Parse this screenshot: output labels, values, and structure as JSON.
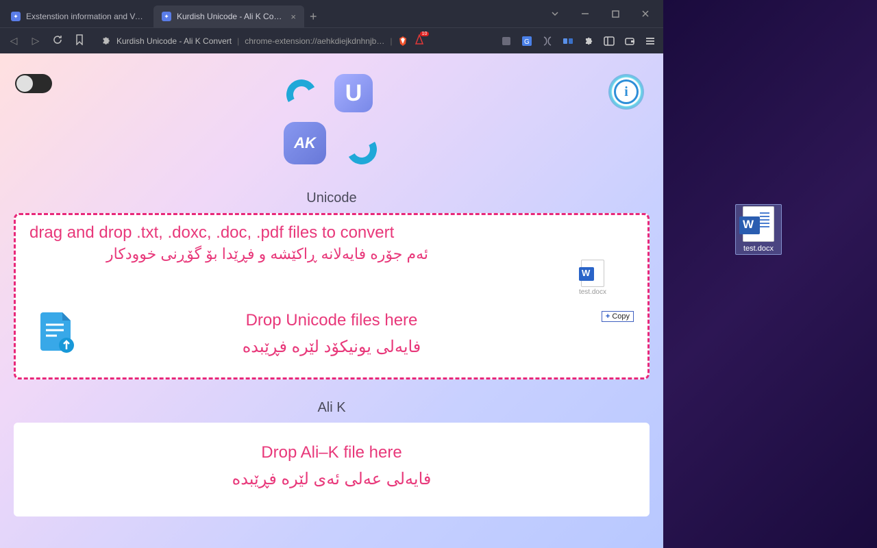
{
  "browser": {
    "tabs": [
      {
        "title": "Exstenstion information and Version",
        "active": false
      },
      {
        "title": "Kurdish Unicode - Ali K Converter",
        "active": true
      }
    ],
    "address": {
      "title": "Kurdish Unicode - Ali K Convert",
      "url": "chrome-extension://aehkdiejkdnhnjb…"
    },
    "shield_badge": "10"
  },
  "page": {
    "logo": {
      "u": "U",
      "ak": "AK"
    },
    "info_label": "i",
    "unicode": {
      "label": "Unicode",
      "hint_en": "drag and drop .txt, .doxc, .doc, .pdf files to convert",
      "hint_ku": "ئەم جۆرە فایەلانە ڕاکێشە و فڕێدا بۆ گۆڕنی خوودکار",
      "drop_en": "Drop Unicode files here",
      "drop_ku": "فایەلی یونیکۆد لێرە فڕێبدە"
    },
    "alik": {
      "label": "Ali K",
      "drop_en": "Drop Ali–K file here",
      "drop_ku": "فایەلی عەلی ئەی لێرە فڕێبدە"
    },
    "drag": {
      "file_name": "test.docx",
      "copy_label": "Copy"
    }
  },
  "desktop": {
    "file_name": "test.docx"
  }
}
